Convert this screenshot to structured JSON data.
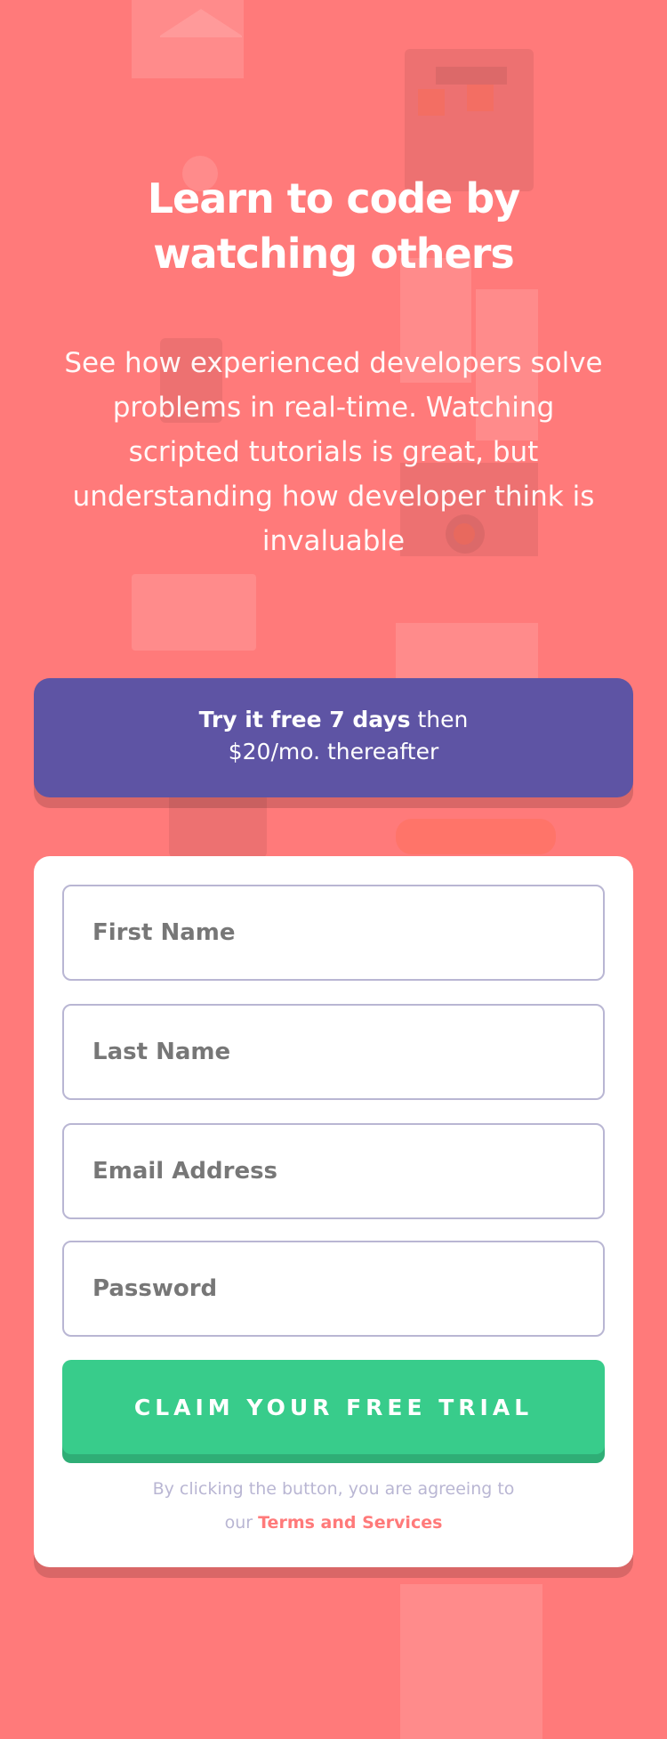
{
  "hero": {
    "title_line1": "Learn to code by",
    "title_line2": "watching others",
    "subtitle": "See how experienced developers solve problems in real-time. Watching scripted tutorials is great, but understanding how developer think is invaluable"
  },
  "promo": {
    "bold_text": "Try it free 7 days",
    "text_after_bold": " then",
    "line2": "$20/mo. thereafter"
  },
  "form": {
    "first_name_placeholder": "First Name",
    "last_name_placeholder": "Last Name",
    "email_placeholder": "Email Address",
    "password_placeholder": "Password",
    "submit_label": "Claim your free trial",
    "legal_line1": "By clicking the button, you are agreeing to",
    "legal_prefix": "our ",
    "terms_link": "Terms and Services"
  },
  "colors": {
    "background": "#ff7a7a",
    "accent_purple": "#5e54a4",
    "accent_green": "#38cc8b",
    "input_border": "#b9b6d3"
  }
}
